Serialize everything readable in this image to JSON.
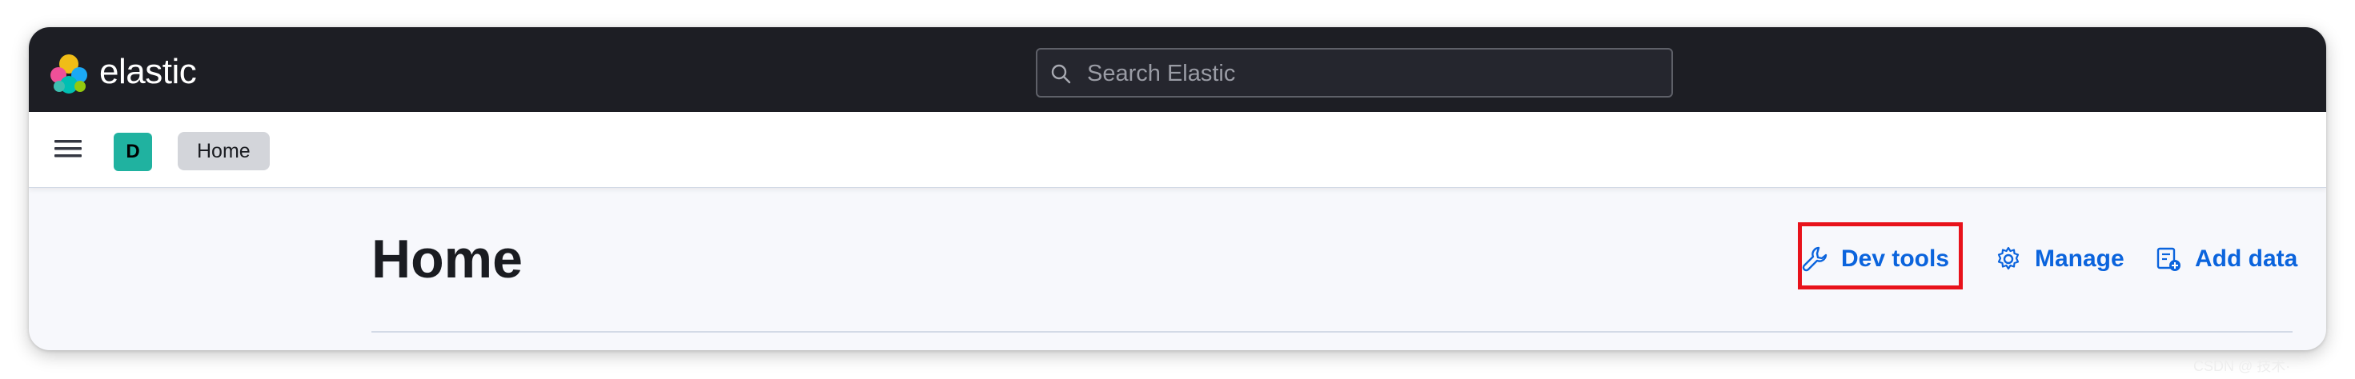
{
  "header": {
    "brand": "elastic",
    "search": {
      "placeholder": "Search Elastic",
      "value": ""
    }
  },
  "navbar": {
    "space_avatar": "D",
    "breadcrumb": "Home"
  },
  "main": {
    "title": "Home",
    "actions": {
      "dev_tools": "Dev tools",
      "manage": "Manage",
      "add_data": "Add data"
    }
  },
  "watermark": "CSDN @ 技术·",
  "colors": {
    "header_bg": "#1d1e24",
    "accent_link": "#0b64dd",
    "space_avatar": "#20b2a0",
    "highlight_box": "#e8121b"
  },
  "icons": [
    "elastic-logo",
    "search-icon",
    "menu-icon",
    "wrench-icon",
    "gear-icon",
    "add-data-icon"
  ]
}
